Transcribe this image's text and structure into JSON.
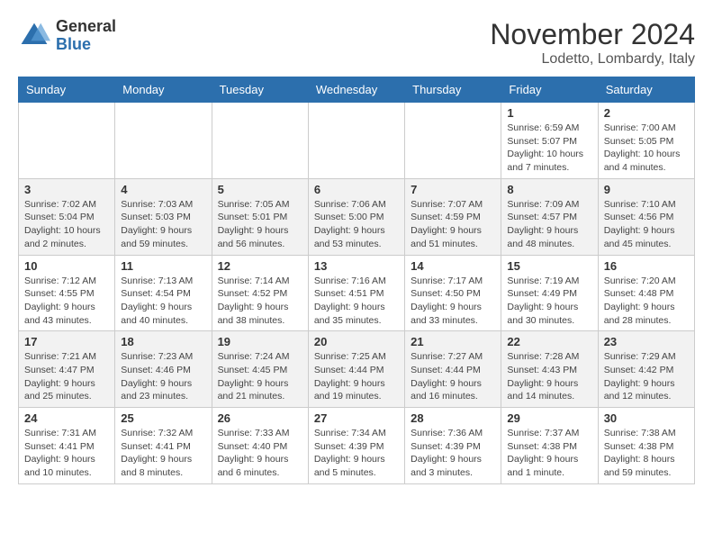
{
  "header": {
    "logo_general": "General",
    "logo_blue": "Blue",
    "month_title": "November 2024",
    "location": "Lodetto, Lombardy, Italy"
  },
  "weekdays": [
    "Sunday",
    "Monday",
    "Tuesday",
    "Wednesday",
    "Thursday",
    "Friday",
    "Saturday"
  ],
  "weeks": [
    [
      {
        "day": "",
        "info": ""
      },
      {
        "day": "",
        "info": ""
      },
      {
        "day": "",
        "info": ""
      },
      {
        "day": "",
        "info": ""
      },
      {
        "day": "",
        "info": ""
      },
      {
        "day": "1",
        "info": "Sunrise: 6:59 AM\nSunset: 5:07 PM\nDaylight: 10 hours and 7 minutes."
      },
      {
        "day": "2",
        "info": "Sunrise: 7:00 AM\nSunset: 5:05 PM\nDaylight: 10 hours and 4 minutes."
      }
    ],
    [
      {
        "day": "3",
        "info": "Sunrise: 7:02 AM\nSunset: 5:04 PM\nDaylight: 10 hours and 2 minutes."
      },
      {
        "day": "4",
        "info": "Sunrise: 7:03 AM\nSunset: 5:03 PM\nDaylight: 9 hours and 59 minutes."
      },
      {
        "day": "5",
        "info": "Sunrise: 7:05 AM\nSunset: 5:01 PM\nDaylight: 9 hours and 56 minutes."
      },
      {
        "day": "6",
        "info": "Sunrise: 7:06 AM\nSunset: 5:00 PM\nDaylight: 9 hours and 53 minutes."
      },
      {
        "day": "7",
        "info": "Sunrise: 7:07 AM\nSunset: 4:59 PM\nDaylight: 9 hours and 51 minutes."
      },
      {
        "day": "8",
        "info": "Sunrise: 7:09 AM\nSunset: 4:57 PM\nDaylight: 9 hours and 48 minutes."
      },
      {
        "day": "9",
        "info": "Sunrise: 7:10 AM\nSunset: 4:56 PM\nDaylight: 9 hours and 45 minutes."
      }
    ],
    [
      {
        "day": "10",
        "info": "Sunrise: 7:12 AM\nSunset: 4:55 PM\nDaylight: 9 hours and 43 minutes."
      },
      {
        "day": "11",
        "info": "Sunrise: 7:13 AM\nSunset: 4:54 PM\nDaylight: 9 hours and 40 minutes."
      },
      {
        "day": "12",
        "info": "Sunrise: 7:14 AM\nSunset: 4:52 PM\nDaylight: 9 hours and 38 minutes."
      },
      {
        "day": "13",
        "info": "Sunrise: 7:16 AM\nSunset: 4:51 PM\nDaylight: 9 hours and 35 minutes."
      },
      {
        "day": "14",
        "info": "Sunrise: 7:17 AM\nSunset: 4:50 PM\nDaylight: 9 hours and 33 minutes."
      },
      {
        "day": "15",
        "info": "Sunrise: 7:19 AM\nSunset: 4:49 PM\nDaylight: 9 hours and 30 minutes."
      },
      {
        "day": "16",
        "info": "Sunrise: 7:20 AM\nSunset: 4:48 PM\nDaylight: 9 hours and 28 minutes."
      }
    ],
    [
      {
        "day": "17",
        "info": "Sunrise: 7:21 AM\nSunset: 4:47 PM\nDaylight: 9 hours and 25 minutes."
      },
      {
        "day": "18",
        "info": "Sunrise: 7:23 AM\nSunset: 4:46 PM\nDaylight: 9 hours and 23 minutes."
      },
      {
        "day": "19",
        "info": "Sunrise: 7:24 AM\nSunset: 4:45 PM\nDaylight: 9 hours and 21 minutes."
      },
      {
        "day": "20",
        "info": "Sunrise: 7:25 AM\nSunset: 4:44 PM\nDaylight: 9 hours and 19 minutes."
      },
      {
        "day": "21",
        "info": "Sunrise: 7:27 AM\nSunset: 4:44 PM\nDaylight: 9 hours and 16 minutes."
      },
      {
        "day": "22",
        "info": "Sunrise: 7:28 AM\nSunset: 4:43 PM\nDaylight: 9 hours and 14 minutes."
      },
      {
        "day": "23",
        "info": "Sunrise: 7:29 AM\nSunset: 4:42 PM\nDaylight: 9 hours and 12 minutes."
      }
    ],
    [
      {
        "day": "24",
        "info": "Sunrise: 7:31 AM\nSunset: 4:41 PM\nDaylight: 9 hours and 10 minutes."
      },
      {
        "day": "25",
        "info": "Sunrise: 7:32 AM\nSunset: 4:41 PM\nDaylight: 9 hours and 8 minutes."
      },
      {
        "day": "26",
        "info": "Sunrise: 7:33 AM\nSunset: 4:40 PM\nDaylight: 9 hours and 6 minutes."
      },
      {
        "day": "27",
        "info": "Sunrise: 7:34 AM\nSunset: 4:39 PM\nDaylight: 9 hours and 5 minutes."
      },
      {
        "day": "28",
        "info": "Sunrise: 7:36 AM\nSunset: 4:39 PM\nDaylight: 9 hours and 3 minutes."
      },
      {
        "day": "29",
        "info": "Sunrise: 7:37 AM\nSunset: 4:38 PM\nDaylight: 9 hours and 1 minute."
      },
      {
        "day": "30",
        "info": "Sunrise: 7:38 AM\nSunset: 4:38 PM\nDaylight: 8 hours and 59 minutes."
      }
    ]
  ]
}
